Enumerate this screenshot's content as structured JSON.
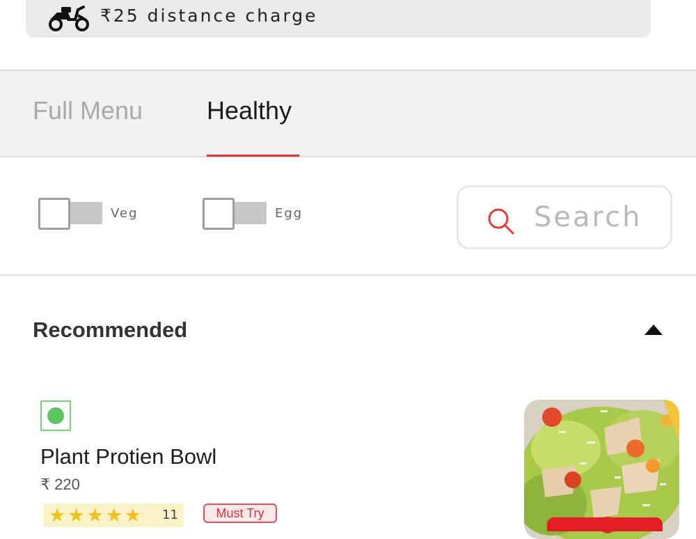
{
  "banner": {
    "icon": "scooter-icon",
    "text": "₹25 distance charge"
  },
  "tabs": [
    {
      "label": "Full Menu",
      "active": false
    },
    {
      "label": "Healthy",
      "active": true
    }
  ],
  "filters": {
    "veg_label": "Veg",
    "veg_on": false,
    "egg_label": "Egg",
    "egg_on": false
  },
  "search": {
    "placeholder": "Search",
    "icon": "search-icon"
  },
  "section": {
    "title": "Recommended",
    "expanded": true
  },
  "item": {
    "name": "Plant Protien Bowl",
    "price": "₹ 220",
    "veg": true,
    "stars": "★★★★★",
    "rating_stars": 4.5,
    "rating_count": "11",
    "badge": "Must Try",
    "image": "salad-bowl-photo"
  },
  "colors": {
    "accent": "#d93535",
    "veg_green": "#5cc45c",
    "star": "#f2c01d"
  }
}
